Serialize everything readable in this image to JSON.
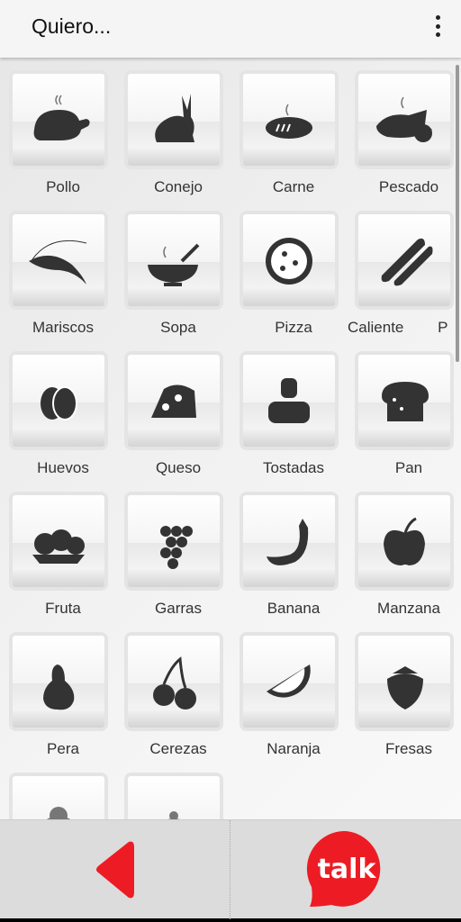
{
  "header": {
    "title": "Quiero...",
    "menu_icon": "more-vert-icon"
  },
  "items": [
    {
      "label": "Pollo",
      "icon": "roast-chicken-icon"
    },
    {
      "label": "Conejo",
      "icon": "rabbit-icon"
    },
    {
      "label": "Carne",
      "icon": "steak-icon"
    },
    {
      "label": "Pescado",
      "icon": "fish-icon"
    },
    {
      "label": "Mariscos",
      "icon": "shrimp-icon"
    },
    {
      "label": "Sopa",
      "icon": "soup-icon"
    },
    {
      "label": "Pizza",
      "icon": "pizza-icon"
    },
    {
      "label": "Caliente        P",
      "icon": "hotdog-icon"
    },
    {
      "label": "Huevos",
      "icon": "eggs-icon"
    },
    {
      "label": "Queso",
      "icon": "cheese-icon"
    },
    {
      "label": "Tostadas",
      "icon": "toaster-icon"
    },
    {
      "label": "Pan",
      "icon": "bread-icon"
    },
    {
      "label": "Fruta",
      "icon": "fruit-bowl-icon"
    },
    {
      "label": "Garras",
      "icon": "grapes-icon"
    },
    {
      "label": "Banana",
      "icon": "banana-icon"
    },
    {
      "label": "Manzana",
      "icon": "apple-icon"
    },
    {
      "label": "Pera",
      "icon": "pear-icon"
    },
    {
      "label": "Cerezas",
      "icon": "cherries-icon"
    },
    {
      "label": "Naranja",
      "icon": "orange-slice-icon"
    },
    {
      "label": "Fresas",
      "icon": "strawberry-icon"
    },
    {
      "label": "",
      "icon": "ice-cream-icon"
    },
    {
      "label": "",
      "icon": "cloche-icon"
    }
  ],
  "bottom": {
    "back_icon": "back-arrow-icon",
    "talk_label": "talk",
    "accent": "#ed1c24"
  }
}
